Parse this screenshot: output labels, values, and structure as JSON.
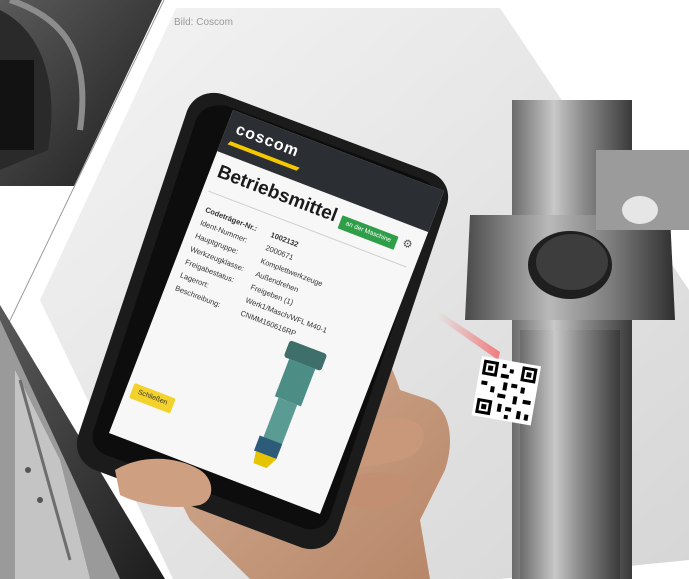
{
  "image_credit": "Bild: Coscom",
  "app": {
    "brand": "coscom",
    "title": "Betriebsmittel",
    "machine_button": "an der Maschine",
    "close_button": "Schließen",
    "fields": [
      {
        "label": "Codeträger-Nr.:",
        "value": "1002132"
      },
      {
        "label": "Ident-Nummer:",
        "value": "2000671"
      },
      {
        "label": "Hauptgruppe:",
        "value": "Komplettwerkzeuge"
      },
      {
        "label": "Werkzeugklasse:",
        "value": "Außendrehen"
      },
      {
        "label": "Freigabestatus:",
        "value": "Freigeben (1)"
      },
      {
        "label": "Lagerort:",
        "value": "Werk1/Masch/WFL M40-1"
      },
      {
        "label": "Beschreibung:",
        "value": "CNMM160616RP"
      }
    ]
  },
  "colors": {
    "brand_yellow": "#f5c800",
    "button_green": "#2f9e48",
    "close_yellow": "#f2d22b",
    "header_dark": "#2b2e33"
  },
  "icons": [
    "settings-icon",
    "qr-code-icon"
  ]
}
